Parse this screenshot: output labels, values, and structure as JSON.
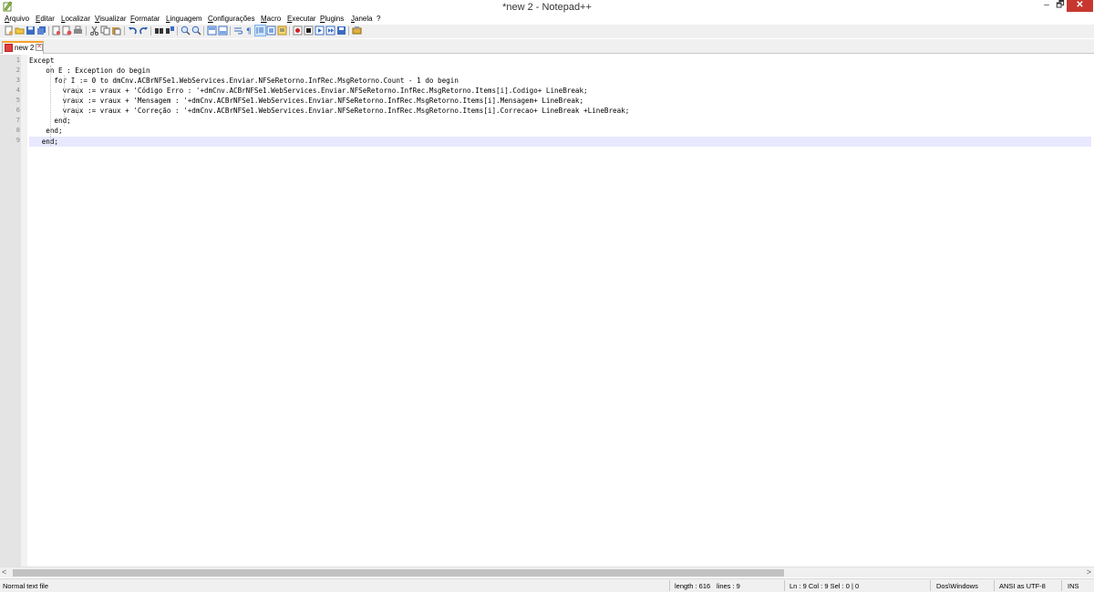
{
  "window": {
    "title": "*new  2 - Notepad++",
    "minimize_glyph": "–",
    "maximize_glyph": "🗗",
    "close_glyph": "✕"
  },
  "menu": [
    "Arquivo",
    "Editar",
    "Localizar",
    "Visualizar",
    "Formatar",
    "Linguagem",
    "Configurações",
    "Macro",
    "Executar",
    "Plugins",
    "Janela",
    "?"
  ],
  "toolbar": {
    "icons": [
      "new-file-icon",
      "open-file-icon",
      "save-icon",
      "save-all-icon",
      "close-icon",
      "close-all-icon",
      "print-icon",
      "cut-icon",
      "copy-icon",
      "paste-icon",
      "undo-icon",
      "redo-icon",
      "find-icon",
      "replace-icon",
      "zoom-in-icon",
      "zoom-out-icon",
      "sync-vertical-icon",
      "sync-horizontal-icon",
      "word-wrap-icon",
      "show-all-chars-icon",
      "indent-guide-icon",
      "user-language-icon",
      "document-map-icon",
      "record-macro-icon",
      "stop-record-icon",
      "play-macro-icon",
      "run-macro-multiple-icon",
      "save-macro-icon",
      "plugin-icon"
    ]
  },
  "tabs": [
    {
      "label": "new 2",
      "close_glyph": "✕"
    }
  ],
  "editor": {
    "line_numbers": [
      "1",
      "2",
      "3",
      "4",
      "5",
      "6",
      "7",
      "8",
      "9"
    ],
    "lines": [
      "Except",
      "    on E : Exception do begin",
      "      for I := 0 to dmCnv.ACBrNFSe1.WebServices.Enviar.NFSeRetorno.InfRec.MsgRetorno.Count - 1 do begin",
      "        vraux := vraux + 'Código Erro : '+dmCnv.ACBrNFSe1.WebServices.Enviar.NFSeRetorno.InfRec.MsgRetorno.Items[i].Codigo+ LineBreak;",
      "        vraux := vraux + 'Mensagem : '+dmCnv.ACBrNFSe1.WebServices.Enviar.NFSeRetorno.InfRec.MsgRetorno.Items[i].Mensagem+ LineBreak;",
      "        vraux := vraux + 'Correção : '+dmCnv.ACBrNFSe1.WebServices.Enviar.NFSeRetorno.InfRec.MsgRetorno.Items[i].Correcao+ LineBreak +LineBreak;",
      "      end;",
      "    end;",
      "   end;"
    ],
    "current_line": 9
  },
  "scrollbar": {
    "left_glyph": "<",
    "right_glyph": ">"
  },
  "status": {
    "file_type": "Normal text file",
    "length": "length : 616",
    "lines": "lines : 9",
    "position": "Ln : 9    Col : 9    Sel : 0 | 0",
    "eol": "Dos\\Windows",
    "encoding": "ANSI as UTF-8",
    "mode": "INS"
  },
  "colors": {
    "accent_tab": "#f7a12a",
    "close_button": "#c7372f",
    "current_line": "#e8e8ff"
  }
}
